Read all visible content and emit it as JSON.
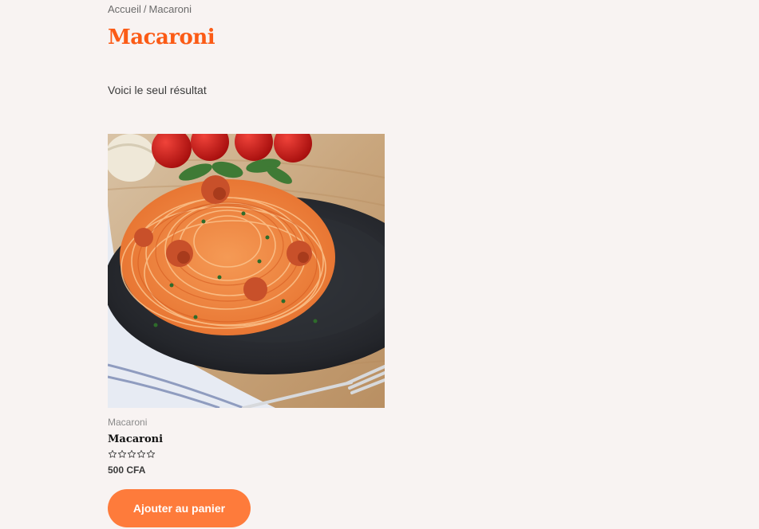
{
  "breadcrumb": {
    "home": "Accueil",
    "separator": "/",
    "current": "Macaroni"
  },
  "page": {
    "title": "Macaroni",
    "result_count": "Voici le seul résultat"
  },
  "product": {
    "category": "Macaroni",
    "name": "Macaroni",
    "rating": 0,
    "rating_max": 5,
    "price": "500 CFA",
    "add_to_cart_label": "Ajouter au panier",
    "image_alt": "Spaghetti à la sauce tomate"
  },
  "colors": {
    "accent": "#fb5b16",
    "button": "#fe7b3b",
    "background": "#f8f3f2"
  }
}
